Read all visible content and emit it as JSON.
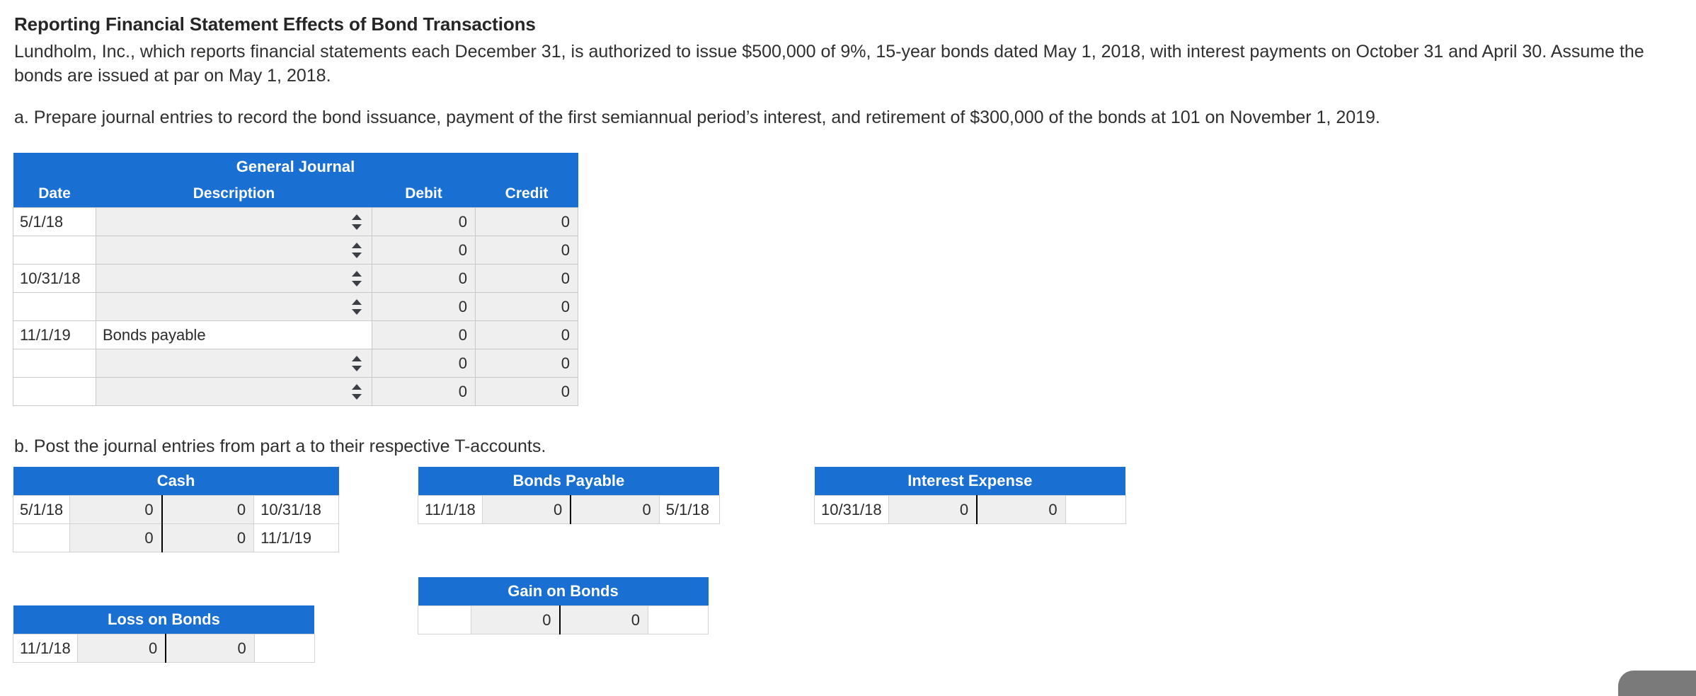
{
  "problem": {
    "title": "Reporting Financial Statement Effects of Bond Transactions",
    "body": "Lundholm, Inc., which reports financial statements each December 31, is authorized to issue $500,000 of 9%, 15-year bonds dated May 1, 2018, with interest payments on October 31 and April 30. Assume the bonds are issued at par on May 1, 2018.",
    "part_a": "a. Prepare journal entries to record the bond issuance, payment of the first semiannual period’s interest, and retirement of $300,000 of the bonds at 101 on November 1, 2019.",
    "part_b": "b. Post the journal entries from part a to their respective T-accounts."
  },
  "colors": {
    "header_blue": "#1a70d2",
    "input_gray": "#efefef",
    "border_gray": "#c9c9c9",
    "text": "#2b2b2b",
    "handle_gray": "#7a7a7a"
  },
  "journal": {
    "title": "General Journal",
    "columns": [
      "Date",
      "Description",
      "Debit",
      "Credit"
    ],
    "rows": [
      {
        "date": "5/1/18",
        "description": "",
        "description_type": "select",
        "debit": "0",
        "credit": "0"
      },
      {
        "date": "",
        "description": "",
        "description_type": "select",
        "debit": "0",
        "credit": "0"
      },
      {
        "date": "10/31/18",
        "description": "",
        "description_type": "select",
        "debit": "0",
        "credit": "0"
      },
      {
        "date": "",
        "description": "",
        "description_type": "select",
        "debit": "0",
        "credit": "0"
      },
      {
        "date": "11/1/19",
        "description": "Bonds payable",
        "description_type": "text",
        "debit": "0",
        "credit": "0"
      },
      {
        "date": "",
        "description": "",
        "description_type": "select",
        "debit": "0",
        "credit": "0"
      },
      {
        "date": "",
        "description": "",
        "description_type": "select",
        "debit": "0",
        "credit": "0"
      }
    ]
  },
  "taccounts": [
    {
      "id": "cash",
      "title": "Cash",
      "rows": [
        {
          "left_date": "5/1/18",
          "debit": "0",
          "credit": "0",
          "right_date": "10/31/18"
        },
        {
          "left_date": "",
          "debit": "0",
          "credit": "0",
          "right_date": "11/1/19"
        }
      ]
    },
    {
      "id": "bonds-payable",
      "title": "Bonds Payable",
      "rows": [
        {
          "left_date": "11/1/18",
          "debit": "0",
          "credit": "0",
          "right_date": "5/1/18"
        }
      ]
    },
    {
      "id": "interest-expense",
      "title": "Interest Expense",
      "rows": [
        {
          "left_date": "10/31/18",
          "debit": "0",
          "credit": "0",
          "right_date": ""
        }
      ]
    },
    {
      "id": "gain-on-bonds",
      "title": "Gain on Bonds",
      "rows": [
        {
          "left_date": "",
          "debit": "0",
          "credit": "0",
          "right_date": ""
        }
      ]
    },
    {
      "id": "loss-on-bonds",
      "title": "Loss on Bonds",
      "rows": [
        {
          "left_date": "11/1/18",
          "debit": "0",
          "credit": "0",
          "right_date": ""
        }
      ]
    }
  ]
}
